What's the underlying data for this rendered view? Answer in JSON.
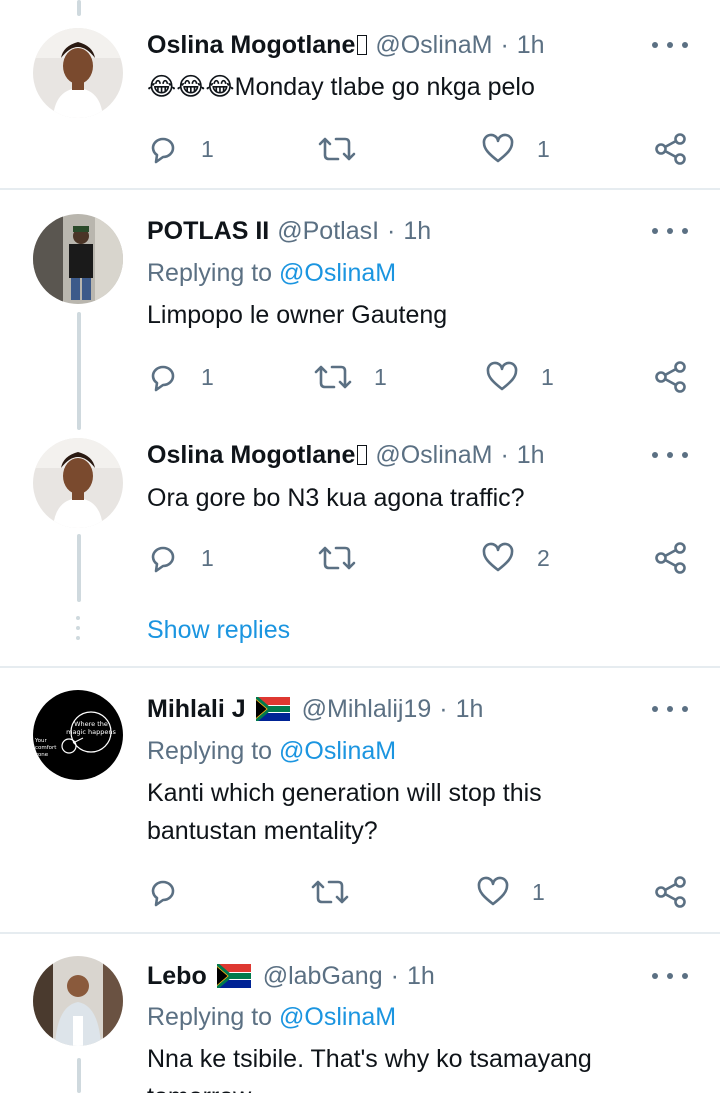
{
  "tweets": [
    {
      "name": "Oslina Mogotlane",
      "handle": "@OslinaM",
      "time": "1h",
      "emojis": "😂😂😂",
      "text": "Monday tlabe go nkga pelo",
      "replies": "1",
      "retweets": "",
      "likes": "1"
    },
    {
      "name": "POTLAS II",
      "handle": "@PotlasI",
      "time": "1h",
      "replying_label": "Replying to",
      "replying_handle": "@OslinaM",
      "text": "Limpopo le owner Gauteng",
      "replies": "1",
      "retweets": "1",
      "likes": "1"
    },
    {
      "name": "Oslina Mogotlane",
      "handle": "@OslinaM",
      "time": "1h",
      "text": "Ora gore bo N3 kua agona traffic?",
      "replies": "1",
      "retweets": "",
      "likes": "2"
    },
    {
      "name": "Mihlali J",
      "handle": "@Mihlalij19",
      "time": "1h",
      "replying_label": "Replying to",
      "replying_handle": "@OslinaM",
      "text_line1": "Kanti which generation will stop this",
      "text_line2": "bantustan mentality?",
      "replies": "",
      "retweets": "",
      "likes": "1",
      "avatar_text_1": "Where the",
      "avatar_text_2": "magic happens",
      "avatar_text_3": "Your",
      "avatar_text_4": "comfort",
      "avatar_text_5": "zone"
    },
    {
      "name": "Lebo",
      "handle": "@labGang",
      "time": "1h",
      "replying_label": "Replying to",
      "replying_handle": "@OslinaM",
      "text_line1": "Nna ke tsibile. That's why ko tsamayang",
      "text_line2": "tomorrow"
    }
  ],
  "show_replies": "Show replies",
  "separator_dot": "·",
  "colors": {
    "link": "#1b95e0",
    "secondary": "#5b7083",
    "divider": "#e6ecf0",
    "thread": "#cfd9de"
  },
  "icons": [
    "reply-icon",
    "retweet-icon",
    "like-icon",
    "share-icon",
    "more-icon",
    "south-africa-flag-icon"
  ]
}
